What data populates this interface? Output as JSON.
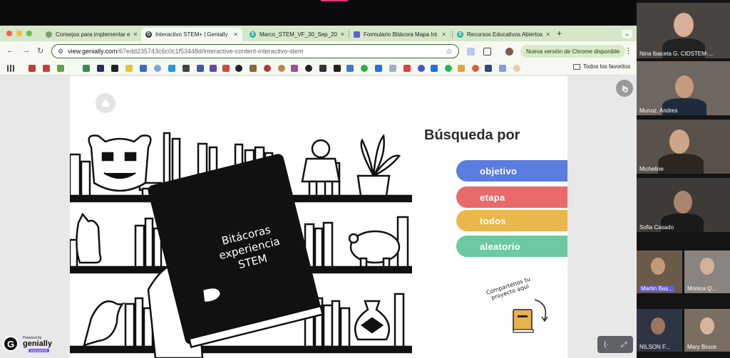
{
  "browser": {
    "tabs": [
      {
        "title": "Consejos para implementar e",
        "icon_color": "#7aa06a",
        "icon": "doc-icon"
      },
      {
        "title": "Interactivo STEM+ | Genially",
        "icon_color": "#333333",
        "icon": "genially-icon"
      },
      {
        "title": "Marco_STEM_VF_30_Sep_20",
        "icon_color": "#2aa7a7",
        "icon": "s-icon"
      },
      {
        "title": "Formulario Bitácora Mapa Int",
        "icon_color": "#5f5fd0",
        "icon": "form-icon"
      },
      {
        "title": "Recursos Educativos Abiertos",
        "icon_color": "#2aa7a7",
        "icon": "s-icon"
      }
    ],
    "url_host": "view.genially.com",
    "url_path": "/67edd235743c6c0c1f53448d/interactive-content-interactivo-stem",
    "update_label": "Nueva versión de Chrome disponible",
    "bookmarks_folder": "Todos los favoritos"
  },
  "slide": {
    "heading": "Búsqueda por",
    "options": [
      {
        "label": "objetivo",
        "color": "#5b7de0"
      },
      {
        "label": "etapa",
        "color": "#e86a6a"
      },
      {
        "label": "todos",
        "color": "#e9b84c"
      },
      {
        "label": "aleatorio",
        "color": "#6cc9a0"
      }
    ],
    "book_title_line1": "Bitácoras",
    "book_title_line2": "experiencia",
    "book_title_line3": "STEM",
    "share_note_line1": "Compartenos tu",
    "share_note_line2": "proyecto aquí"
  },
  "genially_badge": {
    "powered": "Powered by",
    "name": "genially",
    "edition": "EDUCATION"
  },
  "participants": [
    {
      "name": "Nina Ibaceta G. CIDSTEM-...",
      "bg": "#4a4440"
    },
    {
      "name": "Munoz, Andres",
      "bg": "#6e6660"
    },
    {
      "name": "Micheline",
      "bg": "#5a524a"
    },
    {
      "name": "Sofia Casado",
      "bg": "#3e3a38"
    },
    {
      "name": "Martin Bas...",
      "bg": "#6b5a4a"
    },
    {
      "name": "Monica Q...",
      "bg": "#8a8480"
    },
    {
      "name": "NILSON F...",
      "bg": "#2f3442"
    },
    {
      "name": "Mary Bruce",
      "bg": "#7a6e60"
    }
  ]
}
